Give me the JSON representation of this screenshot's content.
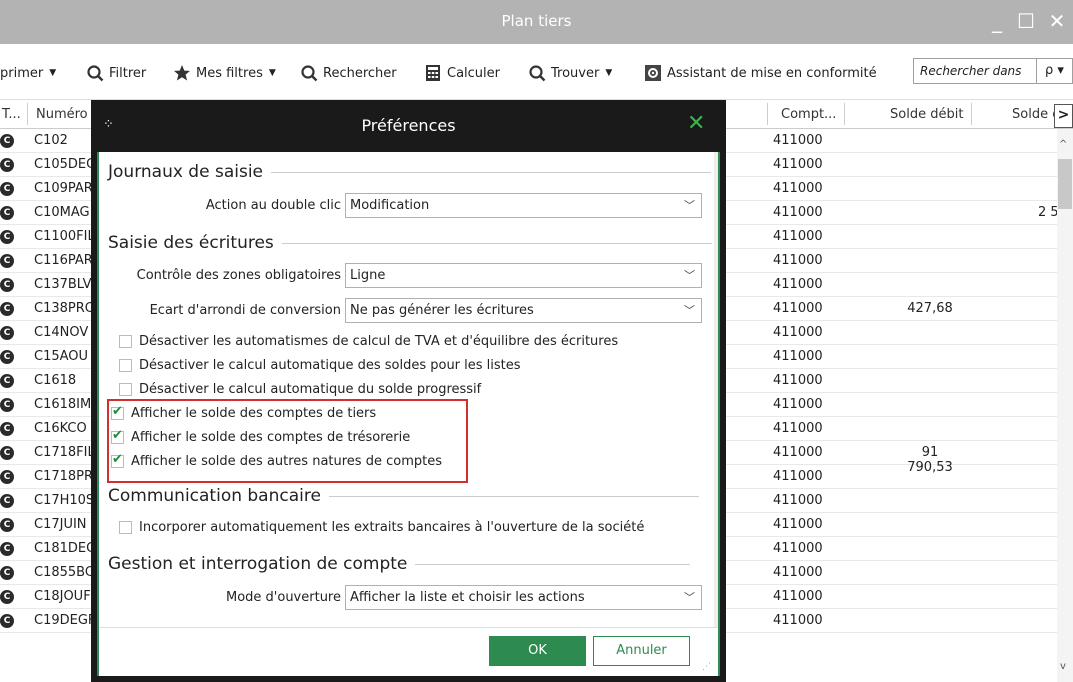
{
  "window": {
    "title": "Plan tiers",
    "minimize": "_",
    "maximize": "☐",
    "close": "✕"
  },
  "toolbar": {
    "print_label": "primer",
    "filter_label": "Filtrer",
    "my_filters_label": "Mes filtres",
    "search_label": "Rechercher",
    "calc_label": "Calculer",
    "find_label": "Trouver",
    "assistant_label": "Assistant de mise en conformité",
    "search_placeholder": "Rechercher dans",
    "search_btn": "ρ ▾"
  },
  "grid": {
    "headers": {
      "type": "T...",
      "number": "Numéro",
      "account": "Compt...",
      "debit": "Solde débit",
      "credit": "Solde c"
    },
    "rows": [
      {
        "num": "C102",
        "compte": "411000",
        "debit": "",
        "credit": ""
      },
      {
        "num": "C105DEC",
        "compte": "411000",
        "debit": "",
        "credit": ""
      },
      {
        "num": "C109PAR",
        "compte": "411000",
        "debit": "",
        "credit": ""
      },
      {
        "num": "C10MAG",
        "compte": "411000",
        "debit": "",
        "credit": "2 5"
      },
      {
        "num": "C1100FIL",
        "compte": "411000",
        "debit": "",
        "credit": ""
      },
      {
        "num": "C116PAR",
        "compte": "411000",
        "debit": "",
        "credit": ""
      },
      {
        "num": "C137BLV",
        "compte": "411000",
        "debit": "",
        "credit": ""
      },
      {
        "num": "C138PRO",
        "compte": "411000",
        "debit": "427,68",
        "credit": ""
      },
      {
        "num": "C14NOV",
        "compte": "411000",
        "debit": "",
        "credit": ""
      },
      {
        "num": "C15AOU",
        "compte": "411000",
        "debit": "",
        "credit": ""
      },
      {
        "num": "C1618",
        "compte": "411000",
        "debit": "",
        "credit": ""
      },
      {
        "num": "C1618IM",
        "compte": "411000",
        "debit": "",
        "credit": ""
      },
      {
        "num": "C16KCO",
        "compte": "411000",
        "debit": "",
        "credit": ""
      },
      {
        "num": "C1718FIL",
        "compte": "411000",
        "debit": "91 790,53",
        "credit": ""
      },
      {
        "num": "C1718PR",
        "compte": "411000",
        "debit": "",
        "credit": ""
      },
      {
        "num": "C17H10S",
        "compte": "411000",
        "debit": "",
        "credit": ""
      },
      {
        "num": "C17JUIN",
        "compte": "411000",
        "debit": "",
        "credit": ""
      },
      {
        "num": "C181DEC",
        "compte": "411000",
        "debit": "",
        "credit": ""
      },
      {
        "num": "C1855BC",
        "compte": "411000",
        "debit": "",
        "credit": ""
      },
      {
        "num": "C18JOUF",
        "compte": "411000",
        "debit": "",
        "credit": ""
      },
      {
        "num": "C19DEGF",
        "compte": "411000",
        "debit": "",
        "credit": ""
      }
    ]
  },
  "dialog": {
    "title": "Préférences",
    "sections": {
      "journaux": "Journaux de saisie",
      "saisie": "Saisie des écritures",
      "communication": "Communication bancaire",
      "gestion": "Gestion et interrogation de compte"
    },
    "fields": {
      "double_click_label": "Action au double clic",
      "double_click_value": "Modification",
      "controle_label": "Contrôle des zones obligatoires",
      "controle_value": "Ligne",
      "ecart_label": "Ecart d'arrondi de conversion",
      "ecart_value": "Ne pas générer les écritures",
      "mode_label": "Mode d'ouverture",
      "mode_value": "Afficher la liste et choisir les actions"
    },
    "checkboxes": [
      {
        "label": "Désactiver les automatismes de calcul de TVA et d'équilibre des écritures",
        "checked": false
      },
      {
        "label": "Désactiver le calcul automatique des soldes pour les listes",
        "checked": false
      },
      {
        "label": "Désactiver le calcul automatique du solde progressif",
        "checked": false
      },
      {
        "label": "Afficher le solde des comptes de tiers",
        "checked": true
      },
      {
        "label": "Afficher le solde des comptes de trésorerie",
        "checked": true
      },
      {
        "label": "Afficher le solde des autres natures de comptes",
        "checked": true
      },
      {
        "label": "Incorporer automatiquement les extraits bancaires à l'ouverture de la société",
        "checked": false
      }
    ],
    "ok_label": "OK",
    "cancel_label": "Annuler"
  },
  "colors": {
    "accent_green": "#2e8b4f",
    "highlight_red": "#d32f2f"
  }
}
